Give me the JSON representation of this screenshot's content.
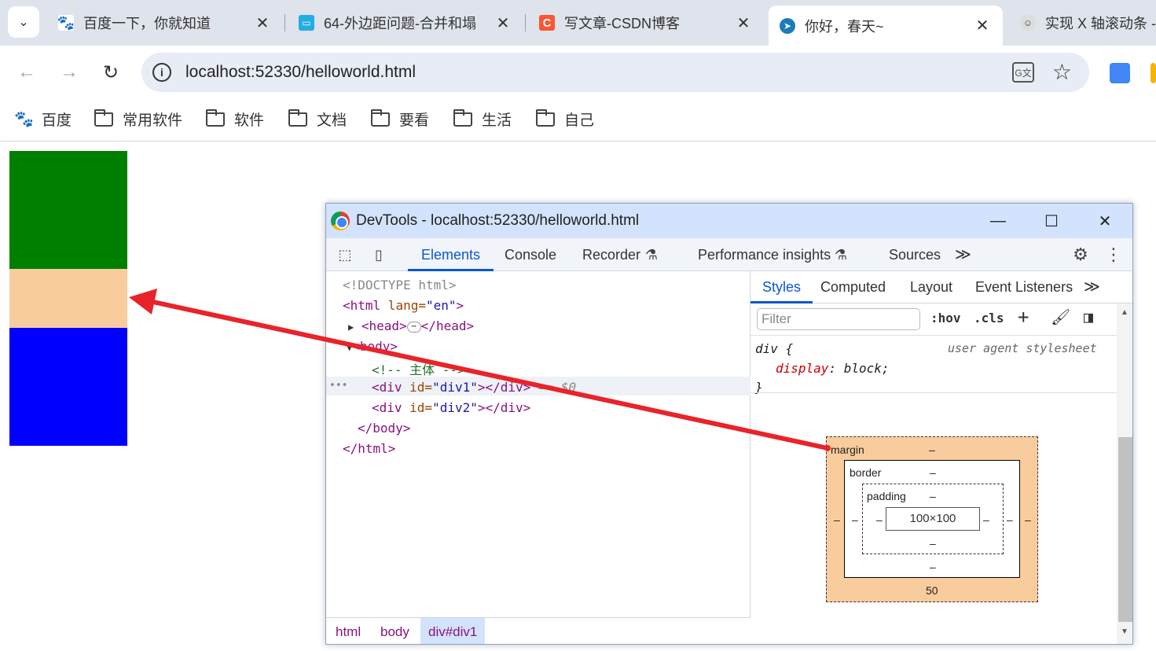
{
  "browser": {
    "tabs": [
      {
        "title": "百度一下，你就知道",
        "favicon": "baidu-paw-icon",
        "color": "#2932e1"
      },
      {
        "title": "64-外边距问题-合并和塌",
        "favicon": "bilibili-tv-icon",
        "color": "#23ade5"
      },
      {
        "title": "写文章-CSDN博客",
        "favicon": "csdn-c-icon",
        "color": "#fc5531"
      },
      {
        "title": "你好，春天~",
        "favicon": "vscode-live-icon",
        "color": "#1c7cba"
      },
      {
        "title": "实现 X 轴滚动条 -",
        "favicon": "avatar-icon",
        "color": "#444444"
      }
    ],
    "tab_close": "✕",
    "url": "localhost:52330/helloworld.html"
  },
  "bookmarks": [
    {
      "label": "百度",
      "icon": "baidu-paw-icon"
    },
    {
      "label": "常用软件",
      "icon": "folder-icon"
    },
    {
      "label": "软件",
      "icon": "folder-icon"
    },
    {
      "label": "文档",
      "icon": "folder-icon"
    },
    {
      "label": "要看",
      "icon": "folder-icon"
    },
    {
      "label": "生活",
      "icon": "folder-icon"
    },
    {
      "label": "自己",
      "icon": "folder-icon"
    }
  ],
  "page_blocks": [
    {
      "name": "green-block",
      "color": "#008000"
    },
    {
      "name": "margin-highlight",
      "color": "#f9cc9d"
    },
    {
      "name": "blue-block",
      "color": "#0000ff"
    }
  ],
  "devtools": {
    "title": "DevTools - localhost:52330/helloworld.html",
    "tabs": [
      "Elements",
      "Console",
      "Recorder",
      "Performance insights",
      "Sources"
    ],
    "active_tab": "Elements",
    "more": "≫",
    "code": {
      "doctype": "<!DOCTYPE html>",
      "html_open_tag": "<html",
      "html_lang_attr": " lang=",
      "html_lang_val": "\"en\"",
      "html_open_end": ">",
      "head_open": "<head>",
      "head_ellipsis": "⋯",
      "head_close": "</head>",
      "body_open": "<body>",
      "comment": "<!-- 主体 -->",
      "div1_open": "<div",
      "div1_id_attr": " id=",
      "div1_id_val": "\"div1\"",
      "div1_close": "></div>",
      "div1_marker": " == $0",
      "div2_open": "<div",
      "div2_id_attr": " id=",
      "div2_id_val": "\"div2\"",
      "div2_close": "></div>",
      "body_close": "</body>",
      "html_close": "</html>",
      "row_dots": "•••"
    },
    "breadcrumbs": [
      "html",
      "body",
      "div#div1"
    ],
    "styles": {
      "tabs": [
        "Styles",
        "Computed",
        "Layout",
        "Event Listeners"
      ],
      "active_tab": "Styles",
      "filter_placeholder": "Filter",
      "hov": ":hov",
      "cls": ".cls",
      "rule_selector": "div {",
      "rule_source": "user agent stylesheet",
      "rule_prop": "display",
      "rule_colon": ": ",
      "rule_value": "block;",
      "rule_end": "}"
    },
    "box_model": {
      "margin_label": "margin",
      "border_label": "border",
      "padding_label": "padding",
      "content": "100×100",
      "dash": "–",
      "margin_bottom": "50",
      "margin_color": "#f9cc9d"
    }
  },
  "arrow_color": "#e8232a"
}
